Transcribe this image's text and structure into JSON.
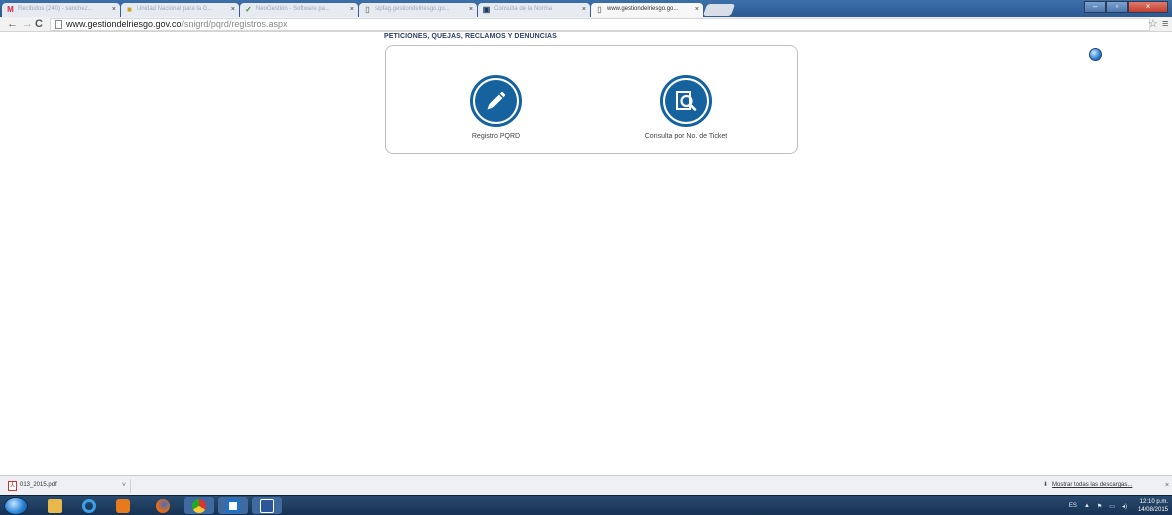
{
  "browser": {
    "tabs": [
      {
        "icon": "gmail-icon",
        "label": "Recibidos (240) - sanchez...",
        "active": false
      },
      {
        "icon": "document-icon",
        "label": "Unidad Nacional para la G...",
        "active": false
      },
      {
        "icon": "neogestion-icon",
        "label": "NeoGestión - Software pa...",
        "active": false
      },
      {
        "icon": "page-icon",
        "label": "sipfag.gestiondelriesgo.go...",
        "active": false
      },
      {
        "icon": "norma-icon",
        "label": "Consulta de la Norma",
        "active": false
      },
      {
        "icon": "page-icon",
        "label": "www.gestiondelriesgo.go...",
        "active": true
      }
    ],
    "close_glyph": "×",
    "url_host": "www.gestiondelriesgo.gov.co",
    "url_path": "/snigrd/pqrd/registros.aspx",
    "back_glyph": "←",
    "forward_glyph": "→",
    "reload_glyph": "C",
    "star_glyph": "☆",
    "menu_glyph": "≡"
  },
  "page": {
    "title": "PETICIONES, QUEJAS, RECLAMOS Y DENUNCIAS",
    "options": [
      {
        "label": "Registro PQRD",
        "icon": "pencil-icon"
      },
      {
        "label": "Consulta por No. de Ticket",
        "icon": "search-document-icon"
      }
    ]
  },
  "downloads": {
    "file": "013_2015.pdf",
    "caret": "˅",
    "show_all": "Mostrar todas las descargas...",
    "close": "×"
  },
  "taskbar": {
    "language": "ES",
    "time": "12:10 p.m.",
    "date": "14/08/2015",
    "apps": [
      "start-orb-icon",
      "explorer-folder-icon",
      "internet-explorer-icon",
      "media-player-icon",
      "firefox-icon",
      "chrome-icon",
      "dropbox-icon",
      "word-icon"
    ]
  },
  "colors": {
    "accent": "#15629e",
    "title": "#2c3e6b",
    "taskbar": "#1d3b5e"
  }
}
